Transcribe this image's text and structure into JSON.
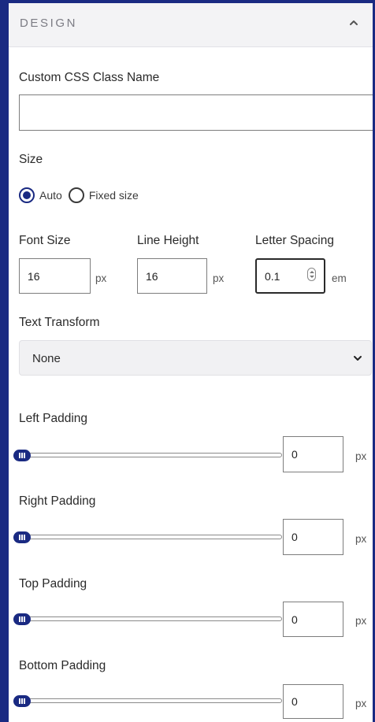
{
  "panel": {
    "title": "DESIGN",
    "accent_color": "#1a2a82"
  },
  "css_class": {
    "label": "Custom CSS Class Name",
    "value": ""
  },
  "size": {
    "label": "Size",
    "options": [
      "Auto",
      "Fixed size"
    ],
    "selected": "Auto"
  },
  "font_size": {
    "label": "Font Size",
    "value": "16",
    "unit": "px"
  },
  "line_height": {
    "label": "Line Height",
    "value": "16",
    "unit": "px"
  },
  "letter_spacing": {
    "label": "Letter Spacing",
    "value": "0.1",
    "unit": "em"
  },
  "text_transform": {
    "label": "Text Transform",
    "selected": "None"
  },
  "paddings": [
    {
      "label": "Left Padding",
      "value": "0",
      "unit": "px"
    },
    {
      "label": "Right Padding",
      "value": "0",
      "unit": "px"
    },
    {
      "label": "Top Padding",
      "value": "0",
      "unit": "px"
    },
    {
      "label": "Bottom Padding",
      "value": "0",
      "unit": "px"
    }
  ]
}
